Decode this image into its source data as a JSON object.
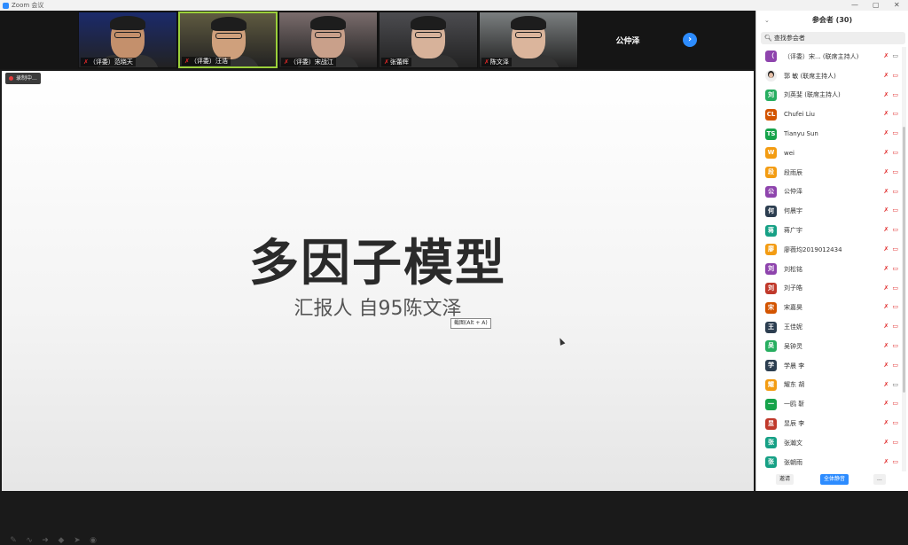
{
  "window": {
    "title": "Zoom 会议",
    "controls": [
      "—",
      "▢",
      "✕"
    ]
  },
  "gallery": {
    "tiles": [
      {
        "name": "（评委）范晓天",
        "muted": true,
        "bg": "#1b2a6b",
        "skin": "#c4906c"
      },
      {
        "name": "（评委）汪浩",
        "muted": true,
        "bg": "#5f5a40",
        "skin": "#cfa07c",
        "active": true
      },
      {
        "name": "（评委）宋战江",
        "muted": true,
        "bg": "#7a6c6c",
        "skin": "#c9a08a"
      },
      {
        "name": "张蕾辉",
        "muted": true,
        "bg": "#4c4c50",
        "skin": "#d7b29a"
      },
      {
        "name": "陈文泽",
        "muted": true,
        "bg": "#7b7f80",
        "skin": "#dbb59c"
      }
    ],
    "name_tile": "公仲泽",
    "next_icon": "chevron-right-icon"
  },
  "share": {
    "recording": "录制中...",
    "title": "多因子模型",
    "subtitle": "汇报人 自95陈文泽",
    "tooltip": "截图(Alt + A)"
  },
  "annotation_tools": [
    "pen-icon",
    "squiggle-icon",
    "arrow-icon",
    "eraser-icon",
    "pointer-icon",
    "record-icon"
  ],
  "panel": {
    "title": "参会者 (30)",
    "collapse_icon": "⌄",
    "search_placeholder": "查找参会者",
    "participants": [
      {
        "avatar": "（",
        "color": "#8e44ad",
        "name": "（评委）宋...  (联席主持人)",
        "video_on": true
      },
      {
        "avatar": "",
        "color": "#ffffff",
        "name": "郭 敏 (联席主持人)",
        "photo": true
      },
      {
        "avatar": "刘",
        "color": "#27ae60",
        "name": "刘英斐 (联席主持人)"
      },
      {
        "avatar": "CL",
        "color": "#d35400",
        "name": "Chufei Liu"
      },
      {
        "avatar": "TS",
        "color": "#16a34a",
        "name": "Tianyu Sun"
      },
      {
        "avatar": "W",
        "color": "#f39c12",
        "name": "wei"
      },
      {
        "avatar": "段",
        "color": "#f39c12",
        "name": "段雨辰"
      },
      {
        "avatar": "公",
        "color": "#8e44ad",
        "name": "公仲泽"
      },
      {
        "avatar": "何",
        "color": "#2c3e50",
        "name": "何晨宇"
      },
      {
        "avatar": "蒋",
        "color": "#16a085",
        "name": "蒋广宇"
      },
      {
        "avatar": "廖",
        "color": "#f39c12",
        "name": "廖薇均2019012434"
      },
      {
        "avatar": "刘",
        "color": "#8e44ad",
        "name": "刘松铭"
      },
      {
        "avatar": "刘",
        "color": "#c0392b",
        "name": "刘子皓"
      },
      {
        "avatar": "宋",
        "color": "#d35400",
        "name": "宋嘉昊"
      },
      {
        "avatar": "王",
        "color": "#2c3e50",
        "name": "王佳妮"
      },
      {
        "avatar": "吴",
        "color": "#27ae60",
        "name": "吴钟灵"
      },
      {
        "avatar": "学",
        "color": "#2c3e50",
        "name": "学晨 李"
      },
      {
        "avatar": "耀",
        "color": "#f39c12",
        "name": "耀东 胡",
        "video_on": true
      },
      {
        "avatar": "一",
        "color": "#16a34a",
        "name": "一鸥 靳"
      },
      {
        "avatar": "昱",
        "color": "#c0392b",
        "name": "昱辰 李"
      },
      {
        "avatar": "张",
        "color": "#16a085",
        "name": "张瀚文"
      },
      {
        "avatar": "张",
        "color": "#16a085",
        "name": "张朝雨"
      }
    ],
    "footer": {
      "invite": "邀请",
      "mute_all": "全体静音",
      "more": "..."
    }
  }
}
